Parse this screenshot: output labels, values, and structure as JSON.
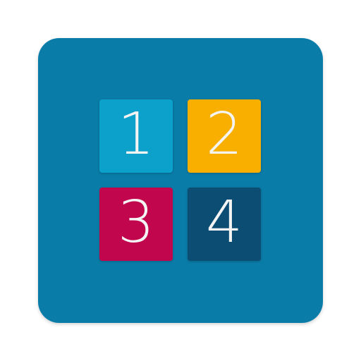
{
  "icon": {
    "background_color": "#0a7ca8",
    "tiles": [
      {
        "label": "1",
        "color": "#0ba1cb"
      },
      {
        "label": "2",
        "color": "#f8af00"
      },
      {
        "label": "3",
        "color": "#c2064e"
      },
      {
        "label": "4",
        "color": "#0b4d73"
      }
    ]
  }
}
